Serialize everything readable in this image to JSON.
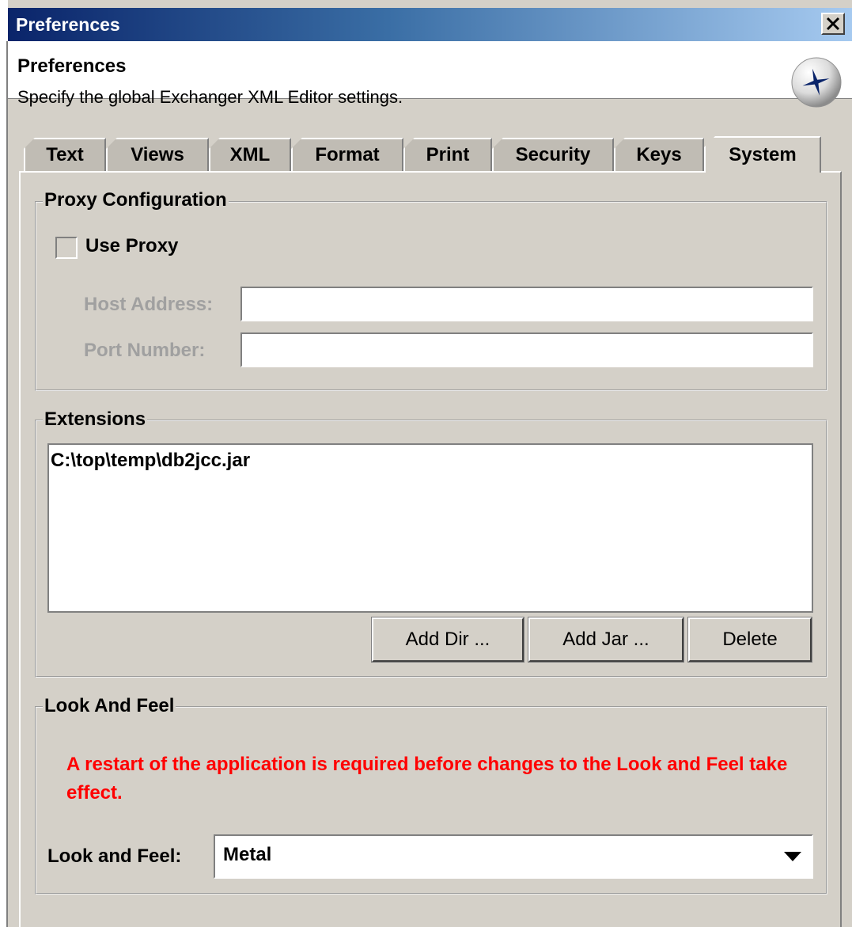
{
  "window": {
    "title": "Preferences"
  },
  "header": {
    "title": "Preferences",
    "subtitle": "Specify the global Exchanger XML Editor settings."
  },
  "tabs": [
    "Text",
    "Views",
    "XML",
    "Format",
    "Print",
    "Security",
    "Keys",
    "System"
  ],
  "selected_tab": "System",
  "proxy": {
    "legend": "Proxy Configuration",
    "use_proxy_label": "Use Proxy",
    "use_proxy_checked": false,
    "host_label": "Host Address:",
    "host_value": "",
    "port_label": "Port Number:",
    "port_value": ""
  },
  "extensions": {
    "legend": "Extensions",
    "items": [
      "C:\\top\\temp\\db2jcc.jar"
    ],
    "add_dir_label": "Add Dir ...",
    "add_jar_label": "Add Jar ...",
    "delete_label": "Delete"
  },
  "look_and_feel": {
    "legend": "Look And Feel",
    "restart_message": "A restart of the application is required before changes to the Look and Feel take effect.",
    "restart_color": "#ff0000",
    "select_label": "Look and Feel:",
    "select_value": "Metal"
  }
}
